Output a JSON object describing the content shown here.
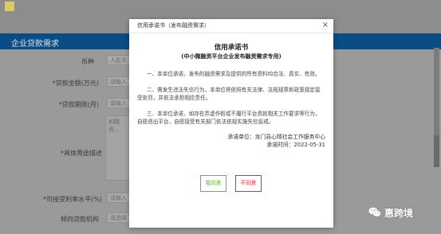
{
  "background": {
    "section_title": "企业贷款需求",
    "fields": [
      {
        "label": "币种",
        "value": "人民币"
      },
      {
        "label": "*贷款金额(万元)",
        "value": "请输入"
      },
      {
        "label": "*贷款期限(月)",
        "value": "请输入"
      },
      {
        "label": "*具体用途描述",
        "value": "如融资..."
      },
      {
        "label": "*可接受利率水平(%)",
        "value": "请输入"
      },
      {
        "label": "倾向贷款机构",
        "value": "请选择"
      }
    ]
  },
  "modal": {
    "header_title": "信用承诺书（发布融资需求）",
    "close_label": "×",
    "title": "信用承诺书",
    "subtitle": "(中小微融资平台企业发布融资需求专用)",
    "paragraphs": [
      "一、本单位承诺，发布的融资需求及提供的所有资料均合法、真实、有效。",
      "二、需发生违法失信行为，本单位将依照有关法律、法规规章和政策规定接受处罚，并依法承担相应责任。",
      "三、本单位承诺，如存在弄虚作假或不履行平台资款相关工作要求等行为，自愿退出平台，自愿接受有关部门依法依规实施失信惩戒。"
    ],
    "sign_unit": "承诺单位：龙门县心晴社会工作服务中心",
    "sign_time": "承诺时间：2022-05-31",
    "agree_label": "我同意",
    "disagree_label": "不同意"
  },
  "watermark": {
    "text": "惠跨境"
  },
  "colors": {
    "section_bar": "#0a4c86",
    "agree": "#52c41a",
    "disagree": "#f5222d"
  }
}
